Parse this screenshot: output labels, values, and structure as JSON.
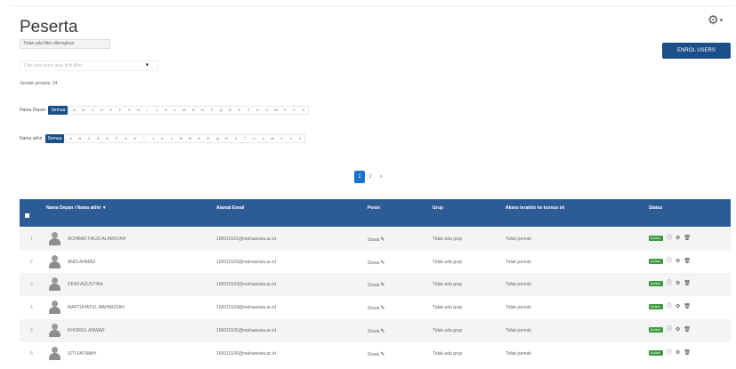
{
  "page": {
    "title": "Peserta"
  },
  "toolbar": {
    "enrol_method": "Tidak ada filter diterapkan",
    "filter_placeholder": "Cari kata kunci atau pilih filter",
    "enrol_button": "ENROL USERS",
    "participant_count": "Jumlah peserta: 24"
  },
  "first_name_filter": {
    "label": "Nama Depan",
    "all": "Semua",
    "letters": [
      "A",
      "B",
      "C",
      "D",
      "E",
      "F",
      "G",
      "H",
      "I",
      "J",
      "K",
      "L",
      "M",
      "N",
      "O",
      "P",
      "Q",
      "R",
      "S",
      "T",
      "U",
      "V",
      "W",
      "X",
      "Y",
      "Z"
    ]
  },
  "last_name_filter": {
    "label": "Nama akhir",
    "all": "Semua",
    "letters": [
      "A",
      "B",
      "C",
      "D",
      "E",
      "F",
      "G",
      "H",
      "I",
      "J",
      "K",
      "L",
      "M",
      "N",
      "O",
      "P",
      "Q",
      "R",
      "S",
      "T",
      "U",
      "V",
      "W",
      "X",
      "Y",
      "Z"
    ]
  },
  "pagination": {
    "pages": [
      "1",
      "2",
      "»"
    ],
    "current": "1"
  },
  "table": {
    "headers": {
      "name": "Nama Depan / Nama akhir ▼",
      "email": "Alamat Email",
      "roles": "Peran",
      "groups": "Grup",
      "last_access": "Akses terakhir ke kursus ini",
      "status": "Status"
    },
    "rows": [
      {
        "num": "1",
        "name": "ACHMAD FAUZI ALAMSYAH",
        "email": "160010101@mahasiswa.ac.id",
        "role": "Siswa",
        "group": "Tidak ada grup",
        "access": "Tidak pernah",
        "status": "Active"
      },
      {
        "num": "2",
        "name": "ANDI AHMAD",
        "email": "160010102@mahasiswa.ac.id",
        "role": "Siswa",
        "group": "Tidak ada grup",
        "access": "Tidak pernah",
        "status": "Active"
      },
      {
        "num": "3",
        "name": "DEWI AGUSTINA",
        "email": "160010103@mahasiswa.ac.id",
        "role": "Siswa",
        "group": "Tidak ada grup",
        "access": "Tidak pernah",
        "status": "Active"
      },
      {
        "num": "4",
        "name": "MAFTUHATUL MAHMUDAH",
        "email": "160010104@mahasiswa.ac.id",
        "role": "Siswa",
        "group": "Tidak ada grup",
        "access": "Tidak pernah",
        "status": "Active"
      },
      {
        "num": "5",
        "name": "KHOIRUL ANWAR",
        "email": "160010105@mahasiswa.ac.id",
        "role": "Siswa",
        "group": "Tidak ada grup",
        "access": "Tidak pernah",
        "status": "Active"
      },
      {
        "num": "6",
        "name": "SITI FATIMAH",
        "email": "160010106@mahasiswa.ac.id",
        "role": "Siswa",
        "group": "Tidak ada grup",
        "access": "Tidak pernah",
        "status": "Active"
      }
    ]
  },
  "icons": {
    "settings": "gear-icon",
    "edit": "pencil-icon",
    "info": "info-icon",
    "settings_row": "cog-icon",
    "delete": "trash-icon"
  },
  "colors": {
    "brand": "#1a4f8a",
    "table_header": "#2d5b96",
    "status_active": "#3c9a3e",
    "pager_active": "#1a73c9"
  }
}
